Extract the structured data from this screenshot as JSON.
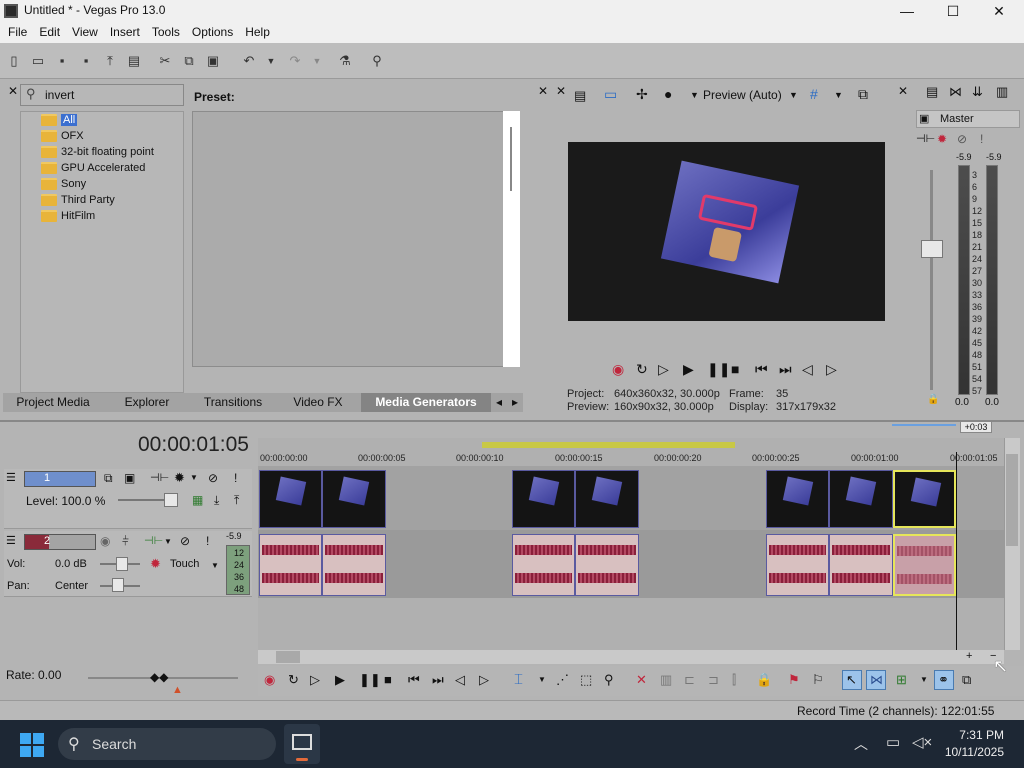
{
  "window": {
    "title": "Untitled * - Vegas Pro 13.0",
    "minimize": "—",
    "maximize": "☐",
    "close": "✕"
  },
  "menu": [
    "File",
    "Edit",
    "View",
    "Insert",
    "Tools",
    "Options",
    "Help"
  ],
  "explorer": {
    "search_value": "invert",
    "items": [
      "All",
      "OFX",
      "32-bit floating point",
      "GPU Accelerated",
      "Sony",
      "Third Party",
      "HitFilm"
    ],
    "preset_label": "Preset:"
  },
  "tabs": [
    "Project Media",
    "Explorer",
    "Transitions",
    "Video FX",
    "Media Generators"
  ],
  "active_tab": "Media Generators",
  "preview": {
    "mode": "Preview (Auto)",
    "project_label": "Project:",
    "project_value": "640x360x32, 30.000p",
    "preview_label": "Preview:",
    "preview_value": "160x90x32, 30.000p",
    "frame_label": "Frame:",
    "frame_value": "35",
    "display_label": "Display:",
    "display_value": "317x179x32"
  },
  "master": {
    "title": "Master",
    "left_peak": "-5.9",
    "right_peak": "-5.9",
    "scale": [
      "3",
      "6",
      "9",
      "12",
      "15",
      "18",
      "21",
      "24",
      "27",
      "30",
      "33",
      "36",
      "39",
      "42",
      "45",
      "48",
      "51",
      "54",
      "57"
    ],
    "left_value": "0.0",
    "right_value": "0.0"
  },
  "timeline": {
    "current_time": "00:00:01:05",
    "ruler": [
      "00:00:00:00",
      "00:00:00:05",
      "00:00:00:10",
      "00:00:00:15",
      "00:00:00:20",
      "00:00:00:25",
      "00:00:01:00",
      "00:00:01:05"
    ],
    "offset_badge": "+0:03",
    "rate_label": "Rate: 0.00"
  },
  "tracks": {
    "video": {
      "number": "1",
      "level": "Level: 100.0 %"
    },
    "audio": {
      "number": "2",
      "vol": "Vol:",
      "vol_value": "0.0 dB",
      "pan": "Pan:",
      "pan_value": "Center",
      "mode": "Touch",
      "peak": "-5.9",
      "meter_scale": [
        "12",
        "24",
        "36",
        "48"
      ]
    }
  },
  "status": {
    "record_time": "Record Time (2 channels): 122:01:55"
  },
  "taskbar": {
    "search": "Search",
    "time": "7:31 PM",
    "date": "10/11/2025"
  },
  "colors": {
    "accent": "#3b6fd0",
    "waveform": "#8a1f3a",
    "clip_border": "#5a5aa0",
    "selected_clip": "#e6e65a"
  }
}
